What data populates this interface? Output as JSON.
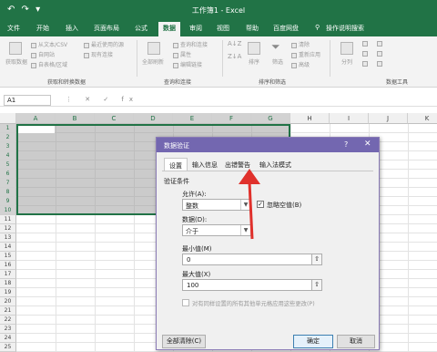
{
  "window": {
    "title": "工作簿1 - Excel",
    "quick_access": "↶ ↷ ▾"
  },
  "tabs": [
    {
      "label": "文件"
    },
    {
      "label": "开始"
    },
    {
      "label": "插入"
    },
    {
      "label": "页面布局"
    },
    {
      "label": "公式"
    },
    {
      "label": "数据"
    },
    {
      "label": "审阅"
    },
    {
      "label": "视图"
    },
    {
      "label": "帮助"
    },
    {
      "label": "百度网盘"
    },
    {
      "label": "操作说明搜索"
    }
  ],
  "ribbon": {
    "get_data": {
      "big_label": "获取数据",
      "items": [
        "从文本/CSV",
        "自网站",
        "自表格/区域",
        "最近使用的源",
        "现有连接"
      ],
      "group": "获取和转换数据"
    },
    "query": {
      "big_label": "全部刷新",
      "items": [
        "查询和连接",
        "属性",
        "编辑链接"
      ],
      "group": "查询和连接"
    },
    "sort_filter": {
      "items": [
        "排序",
        "筛选",
        "清除",
        "重新应用",
        "高级"
      ],
      "group": "排序和筛选"
    },
    "data_tools": {
      "items": [
        "分列",
        "快速填充",
        "删除重复值",
        "数据验证",
        "合并计算",
        "关系",
        "管理数据模型"
      ],
      "group": "数据工具"
    }
  },
  "formula_bar": {
    "name_box": "A1",
    "icons": "⋮ ✕ ✓ fx"
  },
  "grid": {
    "columns": [
      "A",
      "B",
      "C",
      "D",
      "E",
      "F",
      "G",
      "H",
      "I",
      "J",
      "K"
    ],
    "rows": [
      "1",
      "2",
      "3",
      "4",
      "5",
      "6",
      "7",
      "8",
      "9",
      "10",
      "11",
      "12",
      "13",
      "14",
      "15",
      "16",
      "17",
      "18",
      "19",
      "20",
      "21",
      "22",
      "23",
      "24",
      "25"
    ]
  },
  "dialog": {
    "title": "数据验证",
    "help": "?",
    "close": "✕",
    "tabs": [
      "设置",
      "输入信息",
      "出错警告",
      "输入法模式"
    ],
    "section": "验证条件",
    "allow_label": "允许(A):",
    "allow_value": "整数",
    "ignore_blank": "忽略空值(B)",
    "data_label": "数据(D):",
    "data_value": "介于",
    "min_label": "最小值(M)",
    "min_value": "0",
    "max_label": "最大值(X)",
    "max_value": "100",
    "apply_all": "对有同样设置的所有其他单元格应用这些更改(P)",
    "clear_button": "全部清除(C)",
    "ok_button": "确定",
    "cancel_button": "取消"
  },
  "colors": {
    "excel_green": "#217346",
    "dialog_title": "#7367b0",
    "annotation": "#e0312c"
  }
}
